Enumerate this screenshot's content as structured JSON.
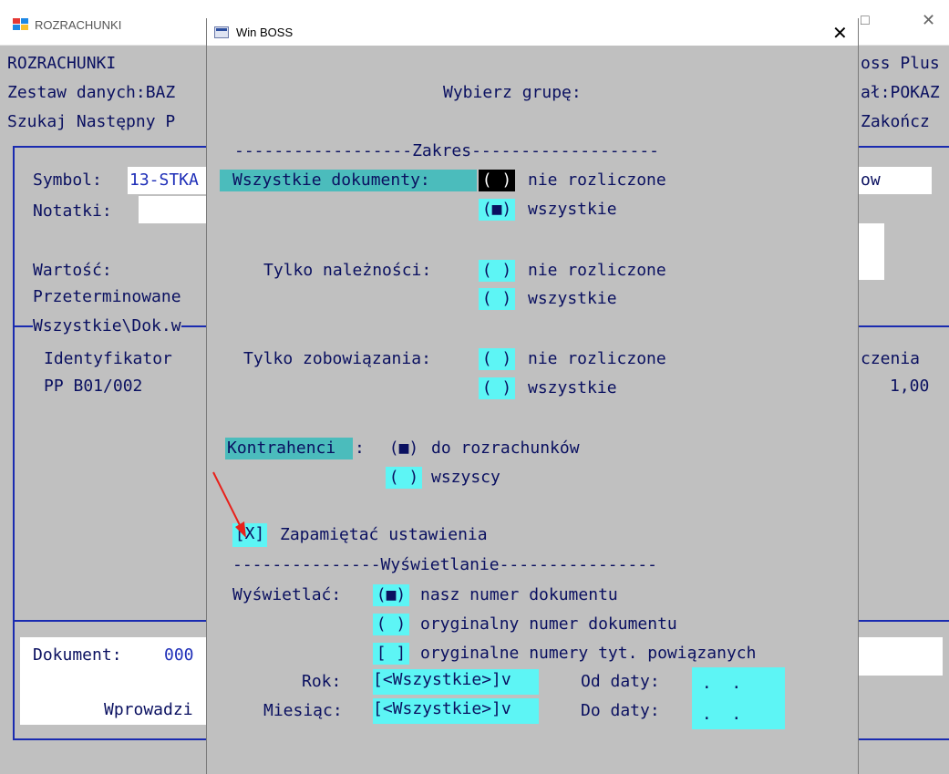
{
  "bg_window": {
    "title": "ROZRACHUNKI",
    "logo_colors": [
      "#e53935",
      "#1e88e5",
      "#1e88e5",
      "#fbc02d"
    ],
    "header_line1_left": "ROZRACHUNKI",
    "header_line1_right": "oss Plus",
    "header_line2_left": "Zestaw danych:BAZ",
    "header_line2_right": "ał:POKAZ",
    "header_line3_left": "Szukaj Następny P",
    "header_line3_right": "Zakończ",
    "symbol_label": "Symbol:",
    "symbol_value": "13-STKA",
    "symbol_right": "ow",
    "notes_label": "Notatki:",
    "value_label": "Wartość:",
    "overdue_label": "Przeterminowane",
    "tab_label": "Wszystkie\\Dok.w",
    "col_identifier": "Identyfikator",
    "col_right": "czenia",
    "row1_id": "PP B01/002",
    "row1_value": "1,00",
    "document_label": "Dokument:",
    "document_value": "000",
    "enter_label": "Wprowadzi"
  },
  "dialog": {
    "title": "Win BOSS",
    "close_icon": "close-icon",
    "heading": "Wybierz grupę:",
    "section_zakres": "------------------Zakres-------------------",
    "all_docs_label": "Wszystkie dokumenty:",
    "receivables_label": "Tylko należności:",
    "liabilities_label": "Tylko zobowiązania:",
    "radio_empty": "( )",
    "radio_selected": "(■)",
    "opt_unsettled": "nie rozliczone",
    "opt_all": "wszystkie",
    "contractors_label": "Kontrahenci",
    "contractors_colon": ":",
    "opt_for_settlements": "do rozrachunków",
    "opt_everyone": "wszyscy",
    "remember_checkbox": "[X]",
    "remember_label": "Zapamiętać ustawienia",
    "section_display": "---------------Wyświetlanie----------------",
    "display_label": "Wyświetlać:",
    "opt_our_number": "nasz numer dokumentu",
    "opt_original_number": "oryginalny numer dokumentu",
    "check_empty": "[ ]",
    "opt_original_related": "oryginalne numery tyt. powiązanych",
    "year_label": "Rok:",
    "year_value": "[<Wszystkie>]v",
    "month_label": "Miesiąc:",
    "month_value": "[<Wszystkie>]v",
    "from_date_label": "Od daty:",
    "to_date_label": "Do daty:",
    "date_placeholder": " .  . "
  },
  "colors": {
    "text": "#0a1060",
    "cyan": "#5df5f5",
    "teal": "#4bbcbc",
    "frame": "#1a2bb0",
    "arrow": "#e8201a"
  }
}
